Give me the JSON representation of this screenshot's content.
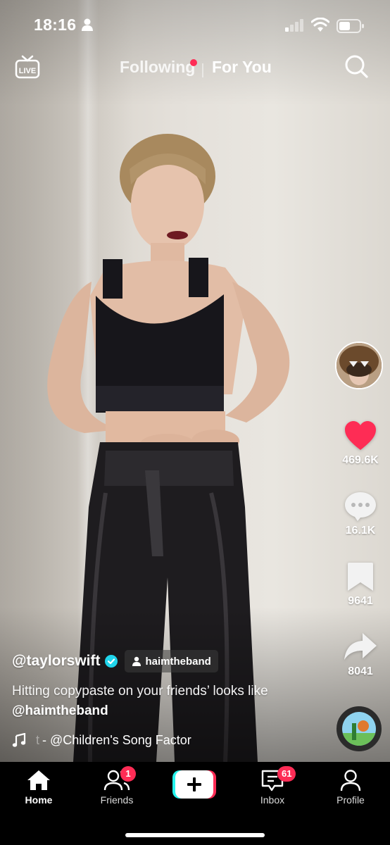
{
  "status_bar": {
    "time": "18:16",
    "icons": [
      "person-icon",
      "cellular-signal-icon",
      "wifi-icon",
      "battery-icon"
    ]
  },
  "top_nav": {
    "live_label": "LIVE",
    "tabs": [
      {
        "label": "Following",
        "has_dot": true
      },
      {
        "label": "For You",
        "active": true
      }
    ],
    "search_icon": "search-icon"
  },
  "colors": {
    "accent": "#fe2c55",
    "verified": "#20d5ec",
    "like_heart": "#fe2c55"
  },
  "right_rail": {
    "like_count": "469.6K",
    "comment_count": "16.1K",
    "save_count": "9641",
    "share_count": "8041"
  },
  "caption": {
    "username": "@taylorswift",
    "collab_user": "haimtheband",
    "description_text": "Hitting copypaste on your friends’ looks like ",
    "description_mention": "@haimtheband",
    "music_prefix": "t",
    "music_text": "- @Children's Song Factor"
  },
  "bottom_nav": {
    "items": [
      {
        "label": "Home",
        "icon": "home-icon",
        "active": true
      },
      {
        "label": "Friends",
        "icon": "friends-icon",
        "badge": "1"
      },
      {
        "label": "",
        "icon": "create-plus-icon"
      },
      {
        "label": "Inbox",
        "icon": "inbox-icon",
        "badge": "61"
      },
      {
        "label": "Profile",
        "icon": "profile-icon"
      }
    ]
  }
}
